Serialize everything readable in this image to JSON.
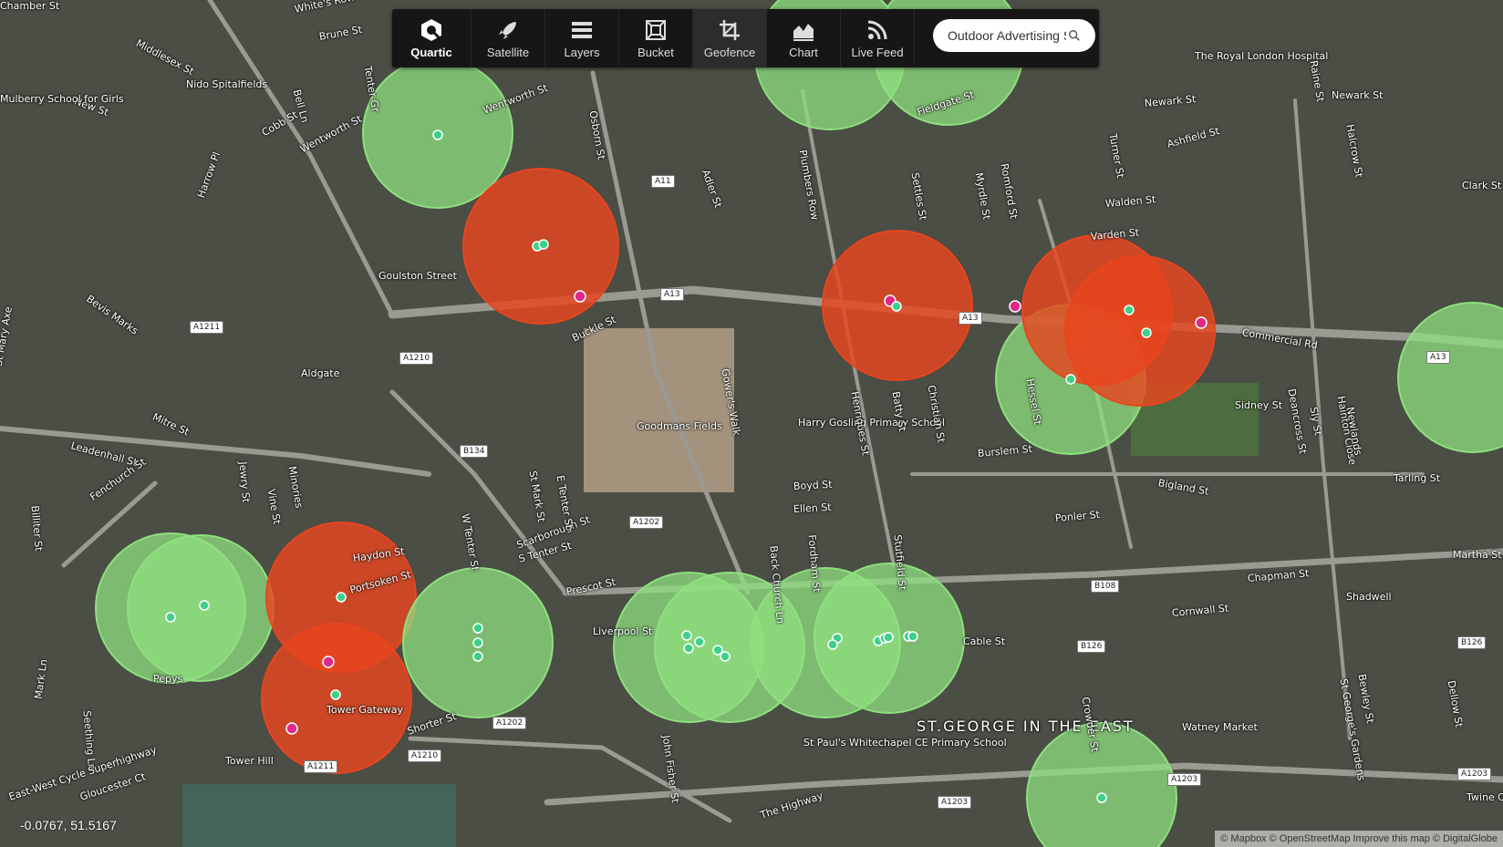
{
  "toolbar": {
    "logo_label": "Quartic",
    "buttons": [
      {
        "label": "Satellite",
        "icon": "rocket-icon"
      },
      {
        "label": "Layers",
        "icon": "layers-icon"
      },
      {
        "label": "Bucket",
        "icon": "bucket-icon"
      },
      {
        "label": "Geofence",
        "icon": "crop-icon"
      },
      {
        "label": "Chart",
        "icon": "area-chart-icon"
      },
      {
        "label": "Live Feed",
        "icon": "rss-icon"
      }
    ],
    "active": "Geofence",
    "search_value": "Outdoor Advertising S"
  },
  "colors": {
    "green_fence": "#8fe07f",
    "red_fence": "#e8451f",
    "green_point": "#3ed08a",
    "pink_point": "#e0288a"
  },
  "street_labels": [
    "White's Row",
    "Middlesex St",
    "Brune St",
    "Nido Spitalfields",
    "Tenter Gr",
    "Bell Ln",
    "New St",
    "Cobb St",
    "Wentworth St",
    "Wentworth St",
    "Goulston Street",
    "Harrow Pl",
    "Bevis Marks",
    "St Mary Axe",
    "Aldgate",
    "Mitre St",
    "Leadenhall St",
    "Fenchurch St",
    "Billiter St",
    "Jewry St",
    "Vine St",
    "Minories",
    "Mark Ln",
    "Seething Ln",
    "Tower Hill",
    "East-West Cycle Superhighway",
    "Gloucester Ct",
    "Pepys",
    "Haydon St",
    "Portsoken St",
    "Tower Gateway",
    "Shorter St",
    "Scarborough St",
    "St Mark St",
    "E Tenter St",
    "W Tenter St",
    "S Tenter St",
    "Prescot St",
    "Buckle St",
    "Goodmans Fields",
    "Gower's Walk",
    "Osborn St",
    "Adler St",
    "Plumbers Row",
    "Settles St",
    "Myrdle St",
    "Romford St",
    "Fieldgate St",
    "Harry Gosling Primary School",
    "Henriques St",
    "Batty St",
    "Christian St",
    "Boyd St",
    "Ellen St",
    "Back Church Ln",
    "Fordham St",
    "Stutfield St",
    "John Fisher St",
    "St Paul's Whitechapel CE Primary School",
    "The Highway",
    "ST.GEORGE IN THE EAST",
    "Burslem St",
    "Hessel St",
    "Bigland St",
    "Ponler St",
    "Cable St",
    "Crowder St",
    "Cornwall St",
    "Chapman St",
    "Shadwell",
    "Martha St",
    "Tarling St",
    "Commercial Rd",
    "Walden St",
    "Varden St",
    "Ashfield St",
    "Newark St",
    "Newark St",
    "Turner St",
    "Halcrow St",
    "Clark St",
    "The Royal London Hospital",
    "Raine St",
    "Deancross St",
    "Hainton Close",
    "Watney Market",
    "St George's Gardens",
    "Bewley St",
    "Dellow St",
    "Twine Ct",
    "Newlands",
    "Sly St",
    "Sidney St",
    "Mulberry School for Girls",
    "Liverpool St",
    "Chamber St"
  ],
  "road_shields": [
    "A11",
    "A1211",
    "A1210",
    "A13",
    "B134",
    "A1202",
    "A1210",
    "A1211",
    "A13",
    "A13",
    "B108",
    "B126",
    "B126",
    "A1203",
    "A1203",
    "A1203",
    "A1202"
  ],
  "coords_text": "-0.0767, 51.5167",
  "attribution": "© Mapbox © OpenStreetMap Improve this map © DigitalGlobe"
}
